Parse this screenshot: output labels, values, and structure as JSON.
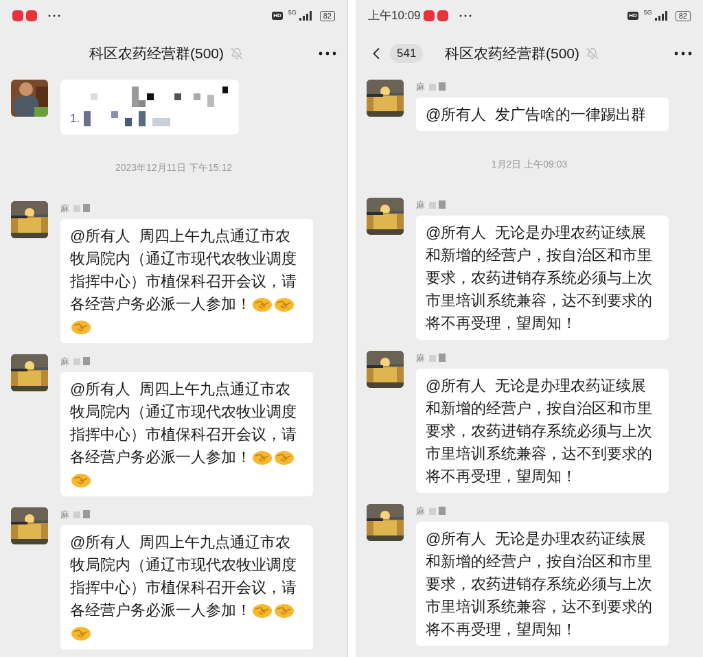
{
  "panels": [
    {
      "status_bar": {
        "hd": "HD",
        "network": "5G",
        "battery": "82"
      },
      "header": {
        "title": "科区农药经营群(500)"
      },
      "messages": [
        {
          "kind": "pixelated",
          "list_marker": "1."
        },
        {
          "kind": "time",
          "text": "2023年12月11日 下午15:12"
        },
        {
          "kind": "text",
          "sender": "麻",
          "text": "@所有人  周四上午九点通辽市农牧局院内（通辽市现代农牧业调度指挥中心）市植保科召开会议，请各经营户务必派一人参加！",
          "reactions": [
            {
              "kind": "handshake"
            },
            {
              "kind": "handshake"
            },
            {
              "kind": "handshake"
            }
          ]
        },
        {
          "kind": "text",
          "sender": "麻",
          "text": "@所有人  周四上午九点通辽市农牧局院内（通辽市现代农牧业调度指挥中心）市植保科召开会议，请各经营户务必派一人参加！",
          "reactions": [
            {
              "kind": "handshake"
            },
            {
              "kind": "handshake"
            },
            {
              "kind": "handshake"
            }
          ]
        },
        {
          "kind": "text",
          "sender": "麻",
          "text": "@所有人  周四上午九点通辽市农牧局院内（通辽市现代农牧业调度指挥中心）市植保科召开会议，请各经营户务必派一人参加！",
          "reactions": [
            {
              "kind": "handshake"
            },
            {
              "kind": "handshake"
            },
            {
              "kind": "handshake"
            }
          ]
        }
      ]
    },
    {
      "status_bar": {
        "time": "上午10:09",
        "hd": "HD",
        "network": "5G",
        "battery": "82"
      },
      "header": {
        "unread": "541",
        "title": "科区农药经营群(500)"
      },
      "messages": [
        {
          "kind": "text",
          "sender": "麻",
          "text": "@所有人  发广告啥的一律踢出群"
        },
        {
          "kind": "time",
          "text": "1月2日 上午09:03"
        },
        {
          "kind": "text",
          "sender": "麻",
          "text": "@所有人  无论是办理农药证续展和新增的经营户，按自治区和市里要求，农药进销存系统必须与上次市里培训系统兼容，达不到要求的将不再受理，望周知！"
        },
        {
          "kind": "text",
          "sender": "麻",
          "text": "@所有人  无论是办理农药证续展和新增的经营户，按自治区和市里要求，农药进销存系统必须与上次市里培训系统兼容，达不到要求的将不再受理，望周知！"
        },
        {
          "kind": "text",
          "sender": "麻",
          "text": "@所有人  无论是办理农药证续展和新增的经营户，按自治区和市里要求，农药进销存系统必须与上次市里培训系统兼容，达不到要求的将不再受理，望周知！"
        }
      ]
    }
  ]
}
